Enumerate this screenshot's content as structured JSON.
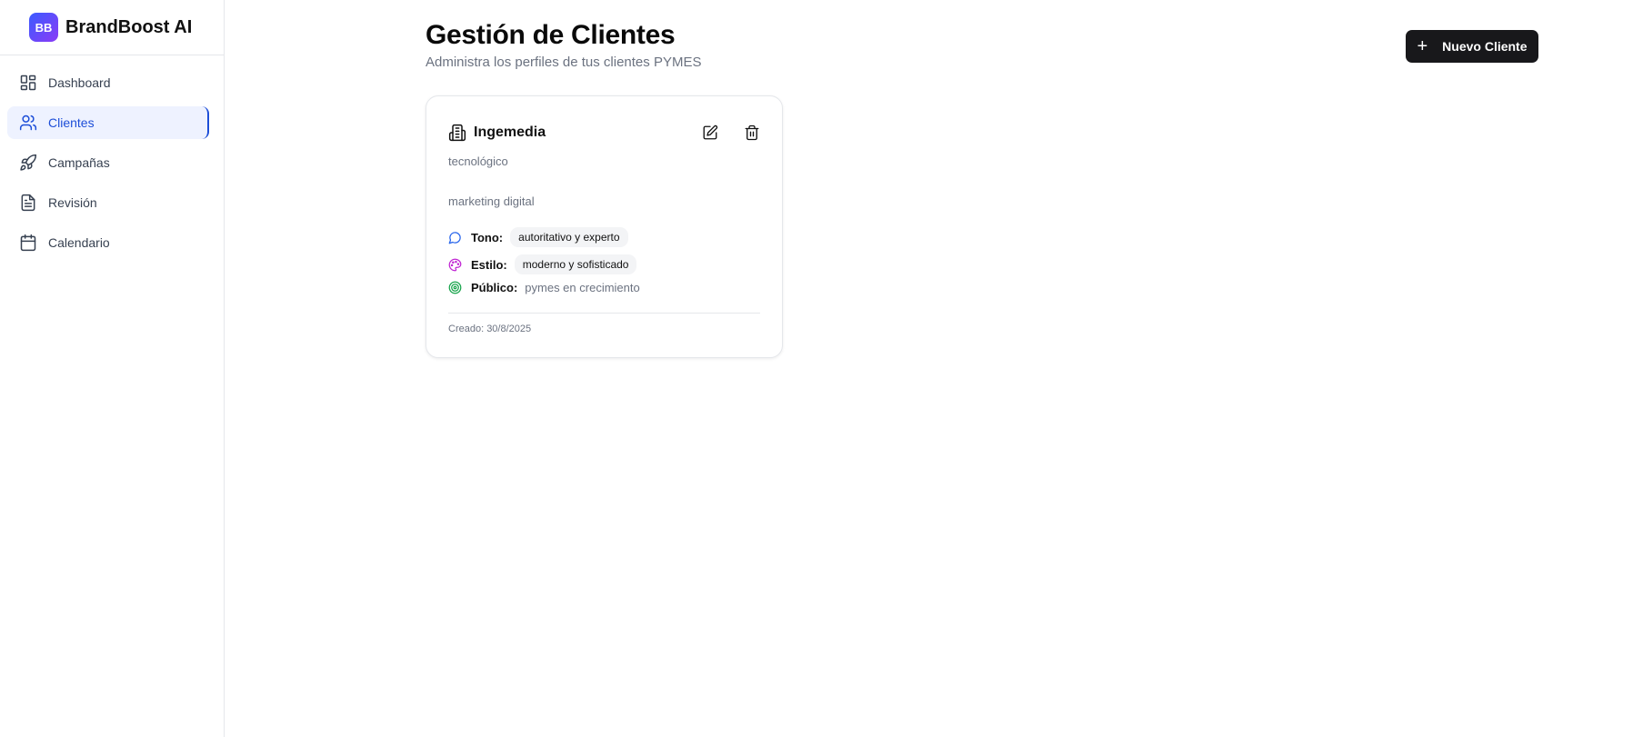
{
  "brand": {
    "logo_text": "BB",
    "name": "BrandBoost AI",
    "gradient_from": "#3b5bff",
    "gradient_to": "#8b3bf6"
  },
  "sidebar": {
    "items": [
      {
        "label": "Dashboard",
        "icon": "dashboard-icon",
        "active": false
      },
      {
        "label": "Clientes",
        "icon": "users-icon",
        "active": true
      },
      {
        "label": "Campañas",
        "icon": "rocket-icon",
        "active": false
      },
      {
        "label": "Revisión",
        "icon": "document-icon",
        "active": false
      },
      {
        "label": "Calendario",
        "icon": "calendar-icon",
        "active": false
      }
    ]
  },
  "header": {
    "title": "Gestión de Clientes",
    "subtitle": "Administra los perfiles de tus clientes PYMES",
    "new_button_icon": "+",
    "new_button_label": "Nuevo Cliente"
  },
  "clients": [
    {
      "name": "Ingemedia",
      "industry": "tecnológico",
      "service": "marketing digital",
      "tone_label": "Tono:",
      "tone": "autoritativo y experto",
      "style_label": "Estilo:",
      "style": "moderno y sofisticado",
      "audience_label": "Público:",
      "audience": "pymes en crecimiento",
      "created": "Creado: 30/8/2025"
    }
  ],
  "colors": {
    "accent": "#1d4ed8",
    "tone_icon": "#2563eb",
    "style_icon": "#c026d3",
    "audience_icon": "#16a34a",
    "button_bg": "#18181b"
  }
}
